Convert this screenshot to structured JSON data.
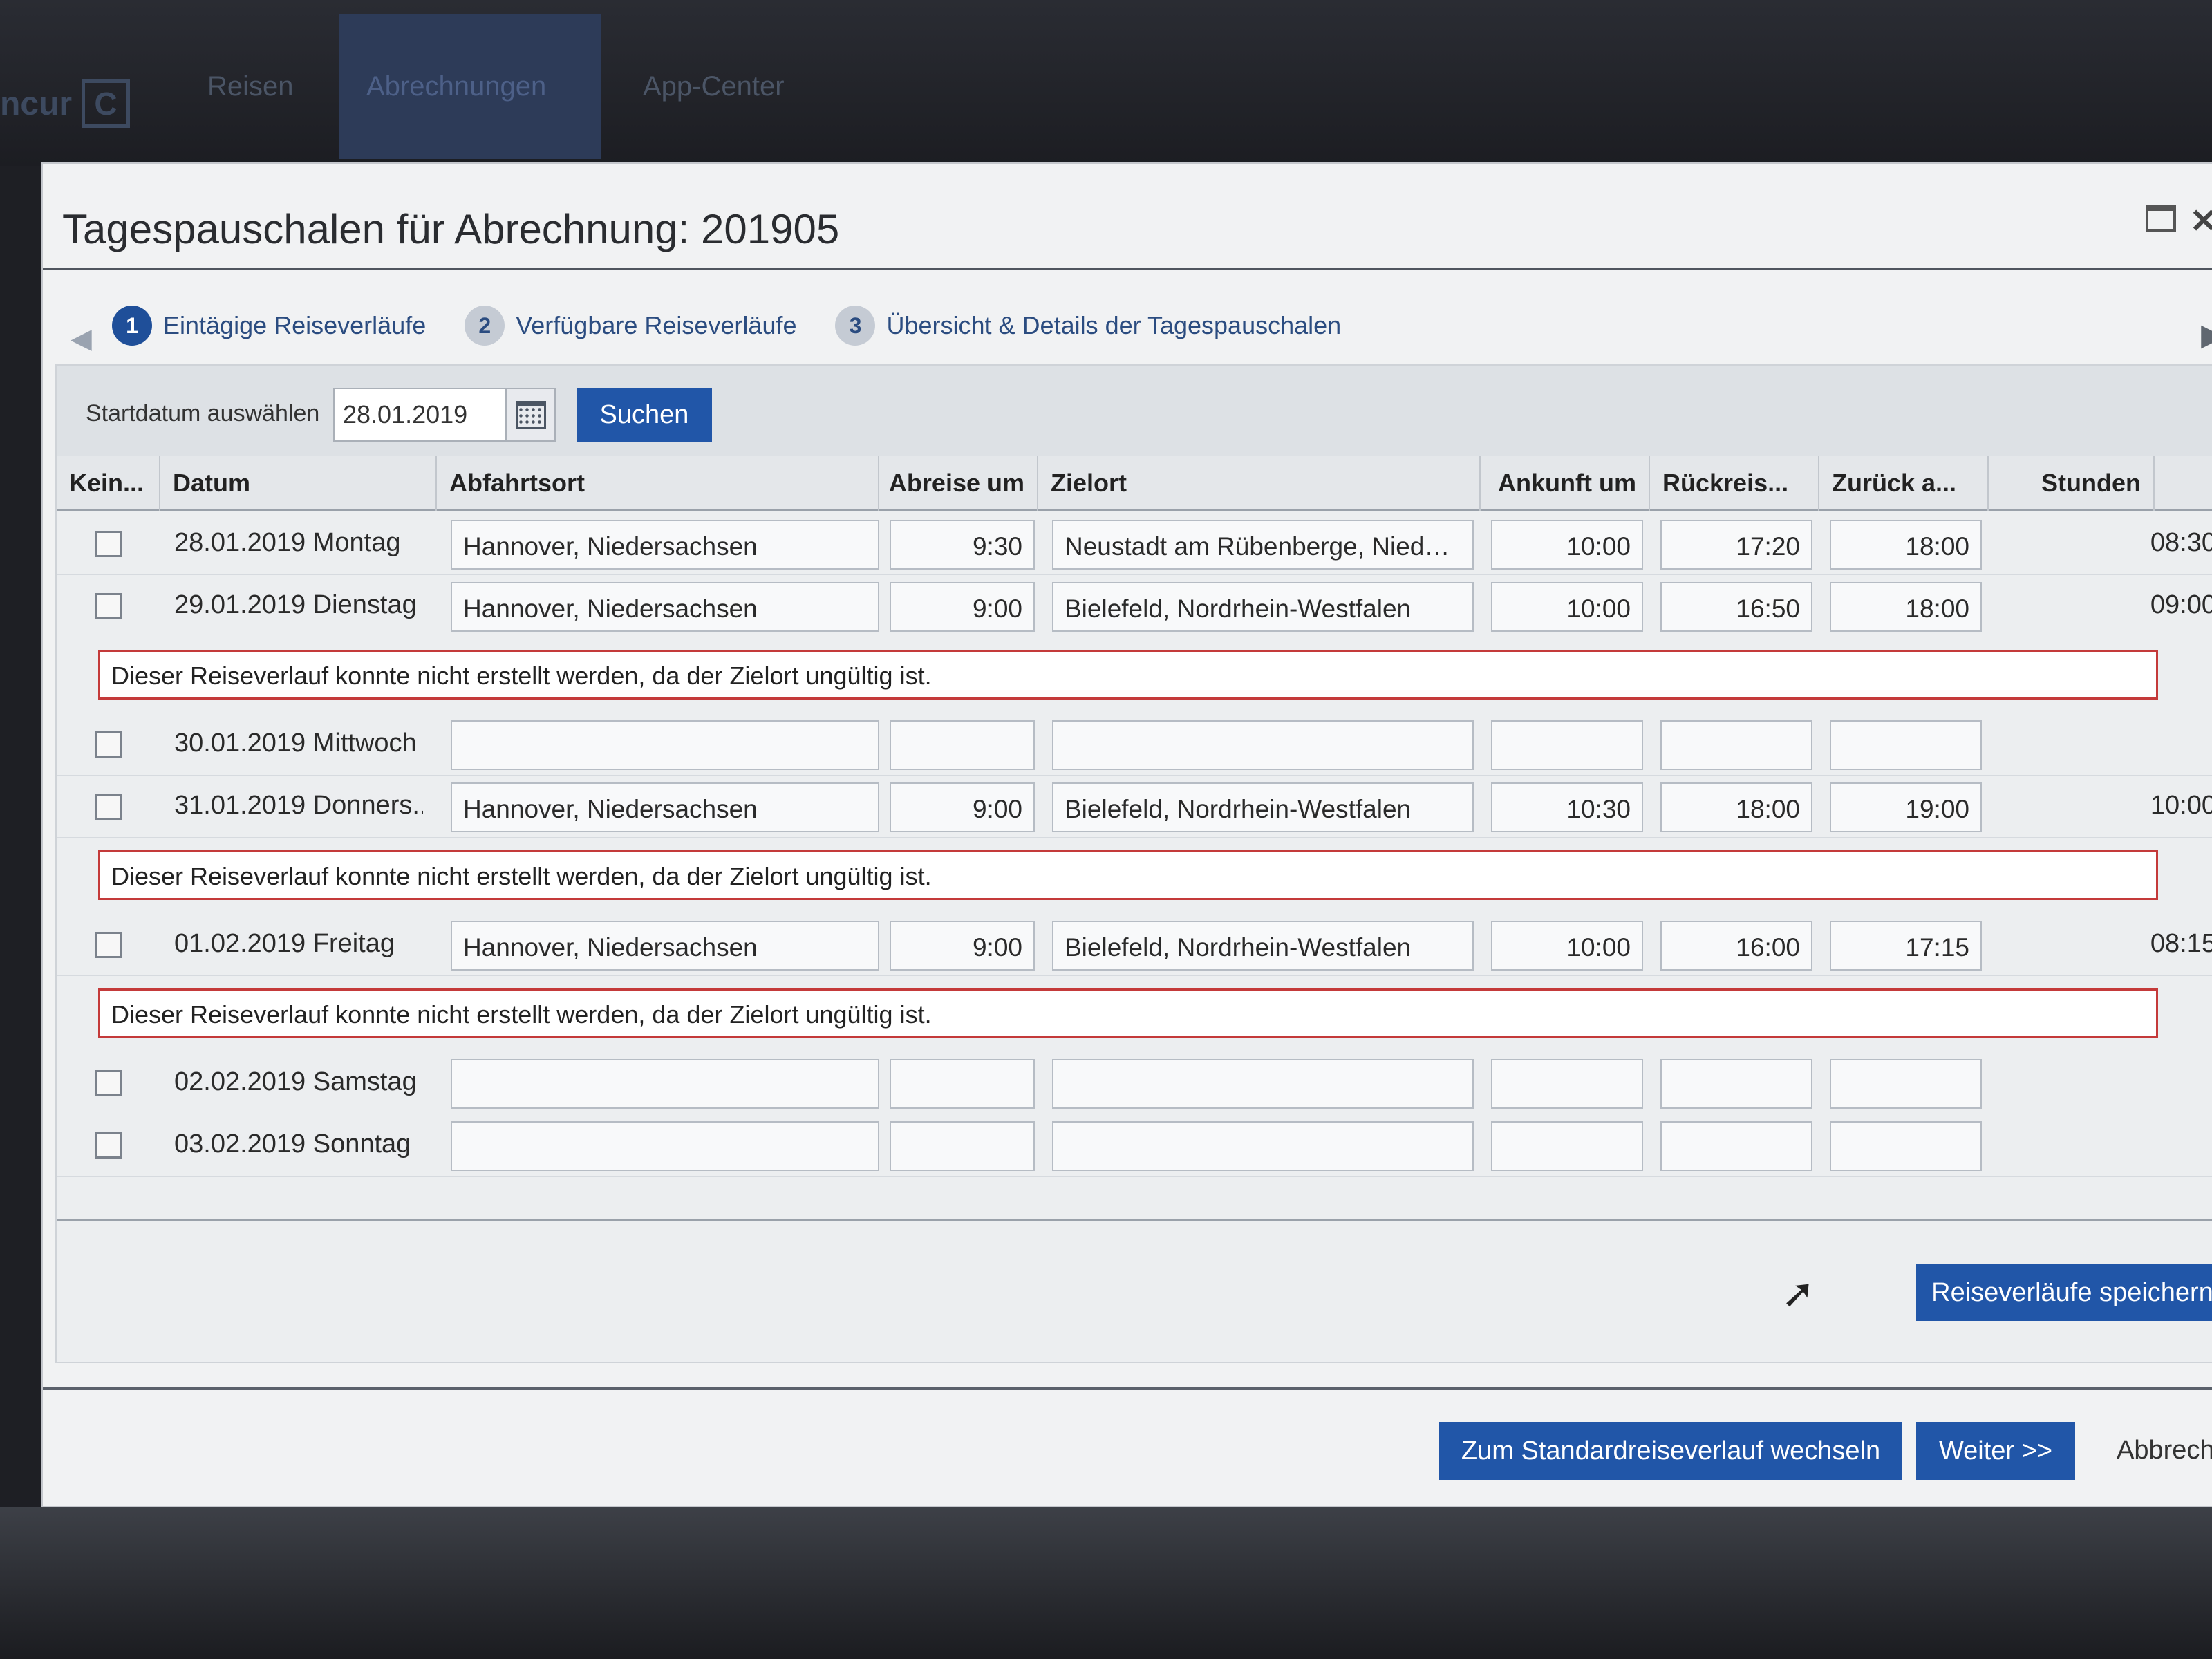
{
  "app": {
    "logo_text": "ncur",
    "logo_letter": "C",
    "nav": [
      "Reisen",
      "Abrechnungen",
      "App-Center"
    ]
  },
  "dialog": {
    "title": "Tagespauschalen für Abrechnung: 201905",
    "steps": [
      {
        "num": "1",
        "label": "Eintägige Reiseverläufe"
      },
      {
        "num": "2",
        "label": "Verfügbare Reiseverläufe"
      },
      {
        "num": "3",
        "label": "Übersicht & Details der Tagespauschalen"
      }
    ],
    "search": {
      "label": "Startdatum auswählen",
      "date_value": "28.01.2019",
      "button": "Suchen"
    },
    "columns": [
      "Kein...",
      "Datum",
      "Abfahrtsort",
      "Abreise um",
      "Zielort",
      "Ankunft um",
      "Rückreis...",
      "Zurück a...",
      "Stunden"
    ],
    "rows": [
      {
        "datum": "28.01.2019 Montag",
        "abfahrtsort": "Hannover, Niedersachsen",
        "abreise": "9:30",
        "zielort": "Neustadt am Rübenberge, Nieder...",
        "ankunft": "10:00",
        "rueckreise": "17:20",
        "zurueck": "18:00",
        "stunden": "08:30"
      },
      {
        "datum": "29.01.2019 Dienstag",
        "abfahrtsort": "Hannover, Niedersachsen",
        "abreise": "9:00",
        "zielort": "Bielefeld, Nordrhein-Westfalen",
        "ankunft": "10:00",
        "rueckreise": "16:50",
        "zurueck": "18:00",
        "stunden": "09:00"
      },
      {
        "datum": "30.01.2019 Mittwoch",
        "abfahrtsort": "",
        "abreise": "",
        "zielort": "",
        "ankunft": "",
        "rueckreise": "",
        "zurueck": "",
        "stunden": ""
      },
      {
        "datum": "31.01.2019 Donners...",
        "abfahrtsort": "Hannover, Niedersachsen",
        "abreise": "9:00",
        "zielort": "Bielefeld, Nordrhein-Westfalen",
        "ankunft": "10:30",
        "rueckreise": "18:00",
        "zurueck": "19:00",
        "stunden": "10:00"
      },
      {
        "datum": "01.02.2019 Freitag",
        "abfahrtsort": "Hannover, Niedersachsen",
        "abreise": "9:00",
        "zielort": "Bielefeld, Nordrhein-Westfalen",
        "ankunft": "10:00",
        "rueckreise": "16:00",
        "zurueck": "17:15",
        "stunden": "08:15"
      },
      {
        "datum": "02.02.2019 Samstag",
        "abfahrtsort": "",
        "abreise": "",
        "zielort": "",
        "ankunft": "",
        "rueckreise": "",
        "zurueck": "",
        "stunden": ""
      },
      {
        "datum": "03.02.2019 Sonntag",
        "abfahrtsort": "",
        "abreise": "",
        "zielort": "",
        "ankunft": "",
        "rueckreise": "",
        "zurueck": "",
        "stunden": ""
      }
    ],
    "error_message": "Dieser Reiseverlauf konnte nicht erstellt werden, da der Zielort ungültig ist.",
    "save_button": "Reiseverläufe speichern",
    "footer": {
      "switch_button": "Zum Standardreiseverlauf wechseln",
      "next_button": "Weiter >>",
      "cancel_link": "Abbreche"
    }
  }
}
